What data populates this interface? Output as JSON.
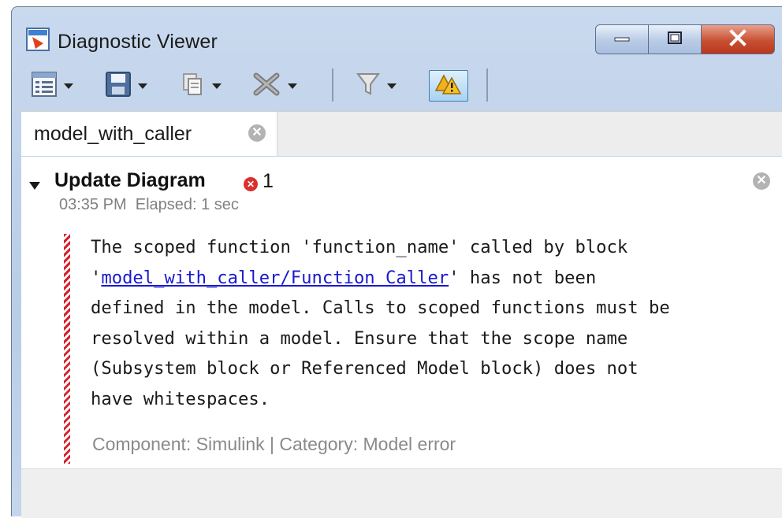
{
  "window": {
    "title": "Diagnostic Viewer"
  },
  "icons": {
    "app": "diagnostic-viewer-app-icon",
    "minimize": "minimize-icon",
    "maximize": "maximize-icon",
    "close": "close-x-icon",
    "toolbar": [
      "view-list-icon",
      "save-icon",
      "copy-icon",
      "delete-x-icon",
      "filter-icon",
      "warnings-toggle-icon"
    ]
  },
  "tabs": [
    {
      "label": "model_with_caller"
    }
  ],
  "section": {
    "title": "Update Diagram",
    "error_count": "1",
    "time": "03:35 PM",
    "elapsed": "Elapsed: 1 sec"
  },
  "message": {
    "line1": "The scoped function 'function_name' called by block",
    "line2_prefix": "'",
    "link": "model_with_caller/Function Caller",
    "line2_suffix": "' has not been",
    "line3": "defined in the model. Calls to scoped functions must be",
    "line4": "resolved within a model. Ensure that the scope name",
    "line5": "(Subsystem block or Referenced Model block) does not",
    "line6": "have whitespaces."
  },
  "meta": {
    "component_label": "Component:",
    "component": "Simulink",
    "separator": "|",
    "category_label": "Category:",
    "category": "Model error"
  },
  "colors": {
    "error": "#d93030",
    "link": "#1a1ad0",
    "close_button": "#c85033",
    "title_bar": "#b9cde8"
  }
}
